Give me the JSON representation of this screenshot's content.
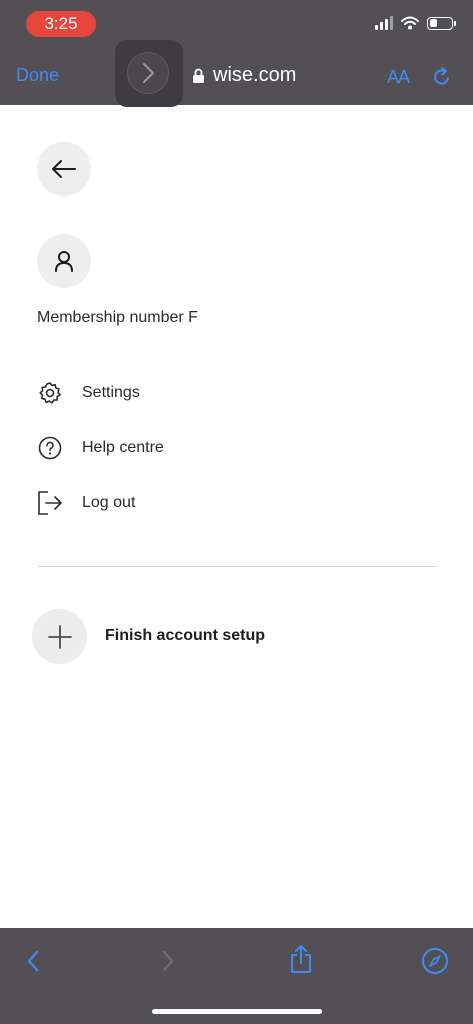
{
  "status_bar": {
    "time": "3:25"
  },
  "browser": {
    "done_label": "Done",
    "domain": "wise.com",
    "text_size_label": "AA"
  },
  "account": {
    "membership_label": "Membership number F"
  },
  "menu": [
    {
      "label": "Settings",
      "icon": "gear-icon"
    },
    {
      "label": "Help centre",
      "icon": "question-circle-icon"
    },
    {
      "label": "Log out",
      "icon": "logout-icon"
    }
  ],
  "finish_setup_label": "Finish account setup",
  "colors": {
    "accent": "#3f8bf0",
    "chrome": "#525054",
    "time_pill": "#e8453c"
  }
}
